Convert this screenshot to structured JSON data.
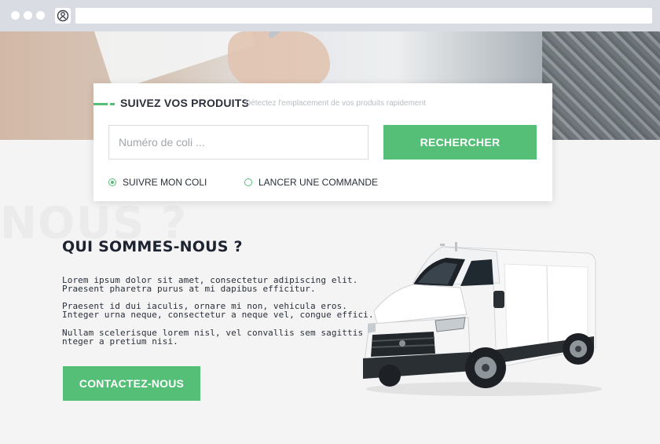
{
  "browser": {
    "url": ""
  },
  "hero": {
    "image": "clipboard-writing-photo"
  },
  "tracking": {
    "title": "SUIVEZ VOS PRODUITS",
    "subtitle": "Détectez l'emplacement de vos produits rapidement",
    "input_value": "",
    "input_placeholder": "Numéro de coli ...",
    "search_button": "RECHERCHER",
    "options": [
      {
        "label": "SUIVRE MON COLI",
        "selected": true
      },
      {
        "label": "LANCER UNE COMMANDE",
        "selected": false
      }
    ]
  },
  "about": {
    "ghost_title": "NOUS ?",
    "title": "QUI SOMMES-NOUS ?",
    "paragraph1": [
      "Lorem ipsum dolor sit amet, consectetur adipiscing elit.",
      "Praesent pharetra purus at mi dapibus efficitur."
    ],
    "paragraph2": [
      "Praesent id dui iaculis, ornare mi non, vehicula eros.",
      "Integer urna neque, consectetur a neque vel, congue effici."
    ],
    "paragraph3": [
      "Nullam scelerisque lorem nisl, vel convallis sem sagittis quis",
      "nteger a pretium nisi."
    ],
    "contact_button": "CONTACTEZ-NOUS",
    "image": "white-delivery-van"
  },
  "colors": {
    "accent": "#55bf78",
    "dark_text": "#1d2330",
    "page_bg": "#f4f4f4",
    "chrome_bg": "#d9dde3"
  }
}
